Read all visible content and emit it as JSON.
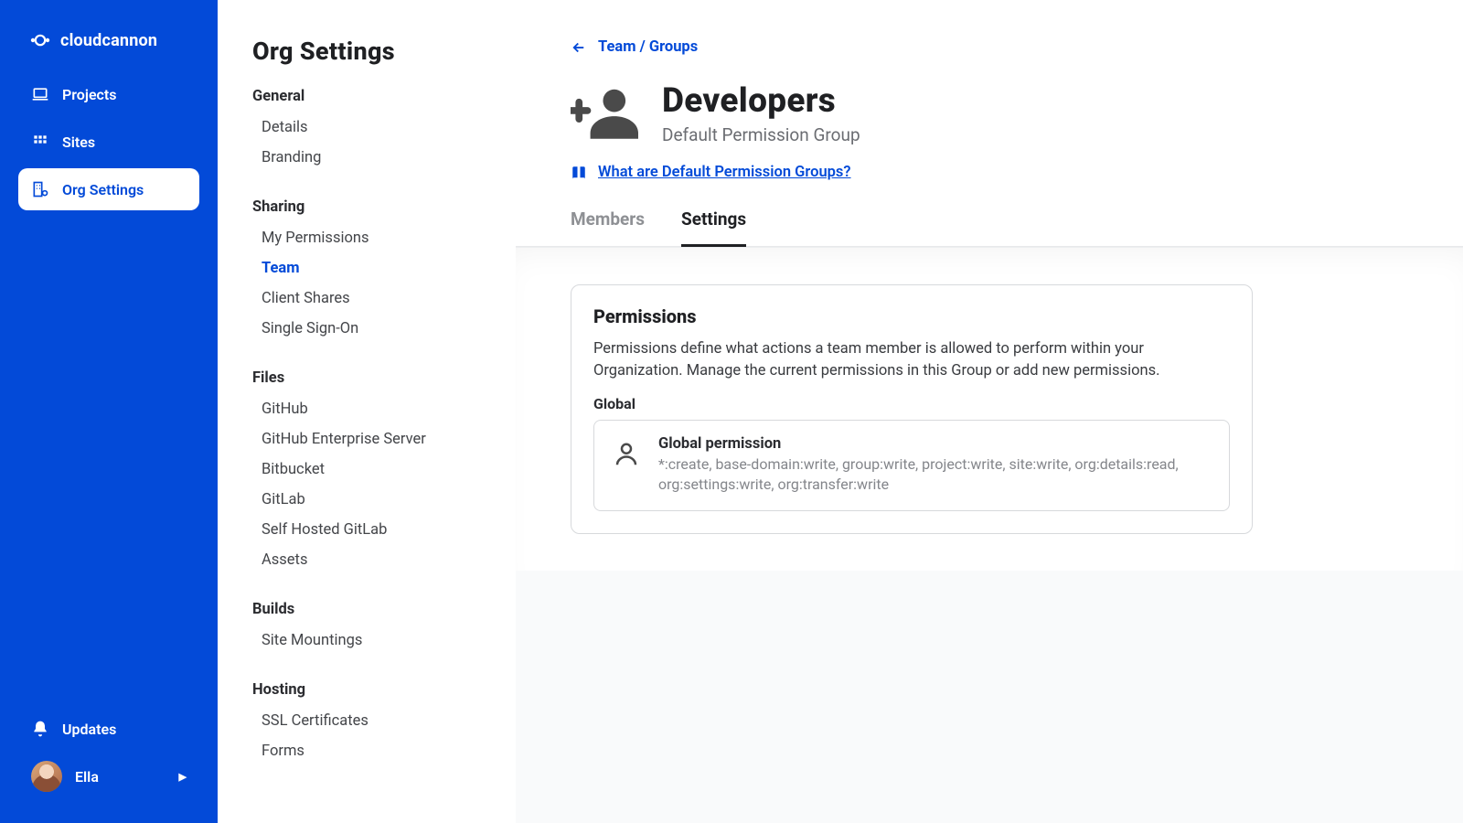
{
  "brand": "cloudcannon",
  "primary_nav": {
    "projects": "Projects",
    "sites": "Sites",
    "org_settings": "Org Settings",
    "updates": "Updates"
  },
  "user": {
    "name": "Ella"
  },
  "secondary": {
    "title": "Org Settings",
    "groups": [
      {
        "heading": "General",
        "items": [
          "Details",
          "Branding"
        ]
      },
      {
        "heading": "Sharing",
        "items": [
          "My Permissions",
          "Team",
          "Client Shares",
          "Single Sign-On"
        ],
        "active": "Team"
      },
      {
        "heading": "Files",
        "items": [
          "GitHub",
          "GitHub Enterprise Server",
          "Bitbucket",
          "GitLab",
          "Self Hosted GitLab",
          "Assets"
        ]
      },
      {
        "heading": "Builds",
        "items": [
          "Site Mountings"
        ]
      },
      {
        "heading": "Hosting",
        "items": [
          "SSL Certificates",
          "Forms"
        ]
      }
    ]
  },
  "breadcrumb": "Team / Groups",
  "page": {
    "title": "Developers",
    "subtitle": "Default Permission Group",
    "help": "What are Default Permission Groups?"
  },
  "tabs": {
    "members": "Members",
    "settings": "Settings"
  },
  "permissions": {
    "heading": "Permissions",
    "desc": "Permissions define what actions a team member is allowed to perform within your Organization. Manage the current permissions in this Group or add new permissions.",
    "scope": "Global",
    "item": {
      "title": "Global permission",
      "detail": "*:create, base-domain:write, group:write, project:write, site:write, org:details:read, org:settings:write, org:transfer:write"
    }
  }
}
